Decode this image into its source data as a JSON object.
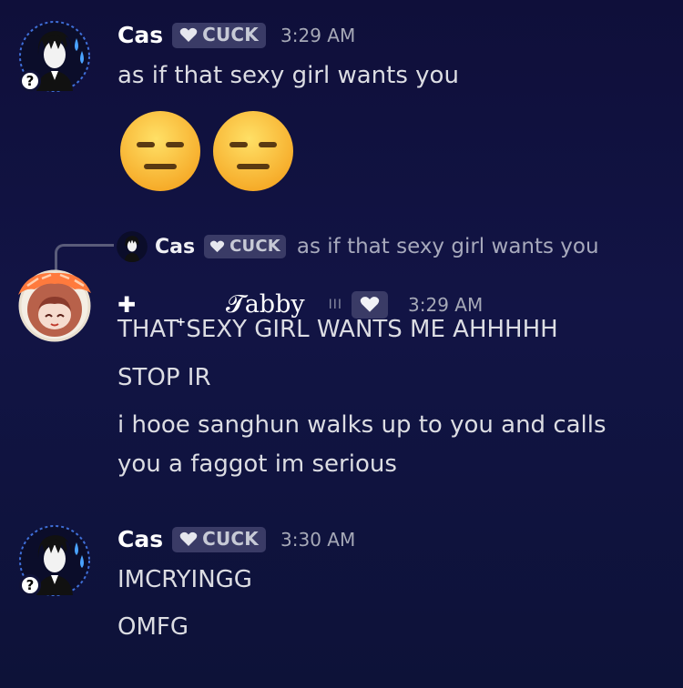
{
  "messages": [
    {
      "username": "Cas",
      "tag": "CUCK",
      "time": "3:29 AM",
      "lines": [
        "as if that sexy girl wants you"
      ],
      "emoji": [
        "expressionless-face",
        "expressionless-face"
      ]
    },
    {
      "reply": {
        "username": "Cas",
        "tag": "CUCK",
        "text": "as if that sexy girl wants you"
      },
      "prefix": "✚",
      "small_plus": "+",
      "username": "𝓣abby",
      "bars": "III",
      "time": "3:29 AM",
      "lines": [
        "THAT SEXY GIRL WANTS ME AHHHHH",
        "STOP IR",
        "i hooe sanghun walks up to you and calls",
        "you a faggot im serious"
      ]
    },
    {
      "username": "Cas",
      "tag": "CUCK",
      "time": "3:30 AM",
      "lines": [
        "IMCRYINGG",
        "OMFG"
      ]
    }
  ],
  "badge": "?",
  "colors": {
    "background": "#121445",
    "tag_bg": "#3a3b66",
    "timestamp": "#a6a9b7",
    "reply_text": "#a7a9bc"
  }
}
